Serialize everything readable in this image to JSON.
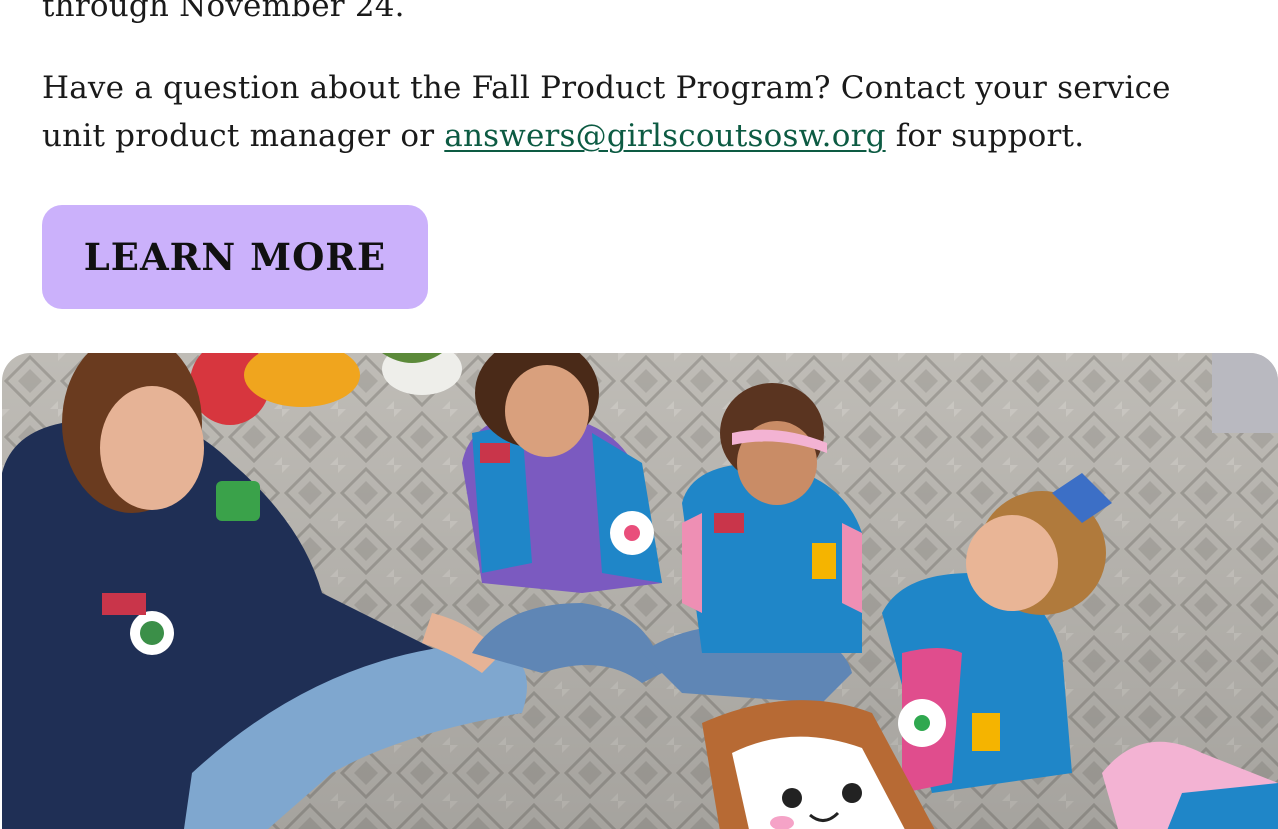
{
  "content": {
    "previous_line": "through November 24.",
    "contact_text_before": "Have a question about the Fall Product Program? Contact your service unit product manager or ",
    "contact_email": "answers@girlscoutsosw.org",
    "contact_text_after": " for support."
  },
  "cta": {
    "label": "LEARN MORE",
    "background_color": "#cbb1fb"
  },
  "colors": {
    "link": "#0d5b43",
    "text": "#1a1a1a"
  },
  "photo": {
    "icon": "photo-girl-scouts-sitting-on-rug"
  }
}
